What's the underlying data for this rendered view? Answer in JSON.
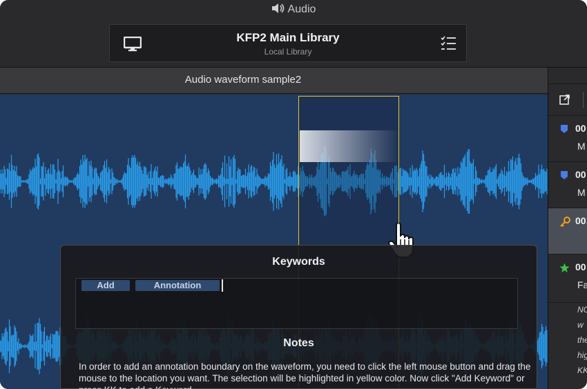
{
  "window": {
    "app_title": "Audio"
  },
  "library": {
    "name": "KFP2 Main Library",
    "subtitle": "Local Library"
  },
  "clip": {
    "title": "Audio waveform sample2"
  },
  "sidebar": {
    "items": [
      {
        "icon": "marker-icon",
        "color": "#4a7be8",
        "line1": "00",
        "line2": "M"
      },
      {
        "icon": "marker-icon",
        "color": "#4a7be8",
        "line1": "00",
        "line2": "M"
      },
      {
        "icon": "key-icon",
        "color": "#f0a020",
        "line1": "00",
        "line2": ""
      },
      {
        "icon": "star-icon",
        "color": "#3ec04a",
        "line1": "00",
        "line2": "Fa"
      }
    ],
    "note_fragments": [
      "NO",
      "w",
      "the",
      "hig",
      "KK"
    ]
  },
  "keywords": {
    "title": "Keywords",
    "tokens": [
      "Add",
      "Annotation"
    ]
  },
  "notes": {
    "title": "Notes",
    "text": "In order to add an annotation boundary on the waveform, you need to click the left mouse button and drag the mouse to the location you want. The selection will be highlighted in yellow color. Now click \"Add Keyword\" or press KK to add a Keyword."
  },
  "colors": {
    "waveform": "#2aa0f0",
    "selection": "#e8c82a",
    "background": "#213a60"
  }
}
